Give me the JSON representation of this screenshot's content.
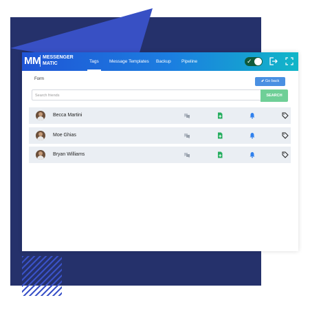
{
  "brand": {
    "mark": "MM",
    "line1": "MESSENGER",
    "line2": "MATIC"
  },
  "nav": [
    {
      "label": "Tags",
      "active": true
    },
    {
      "label": "Message Templates",
      "active": false
    },
    {
      "label": "Backup",
      "active": false
    },
    {
      "label": "Pipeline",
      "active": false
    }
  ],
  "toggle": {
    "on": true
  },
  "form": {
    "label": "Form",
    "go_back_label": "Go back"
  },
  "search": {
    "placeholder": "Search friends",
    "button_label": "SEARCH"
  },
  "friends": [
    {
      "name": "Becca Martini"
    },
    {
      "name": "Moe Ghias"
    },
    {
      "name": "Bryan Williams"
    }
  ],
  "colors": {
    "accent_blue": "#4a90e2",
    "search_green": "#6fcf97",
    "add_green": "#27ae60",
    "bell_blue": "#2f80ed",
    "background_dark": "#25316b"
  },
  "icons": [
    "chat-icon",
    "add-file-icon",
    "bell-icon",
    "tag-icon",
    "logout-icon",
    "expand-icon"
  ]
}
